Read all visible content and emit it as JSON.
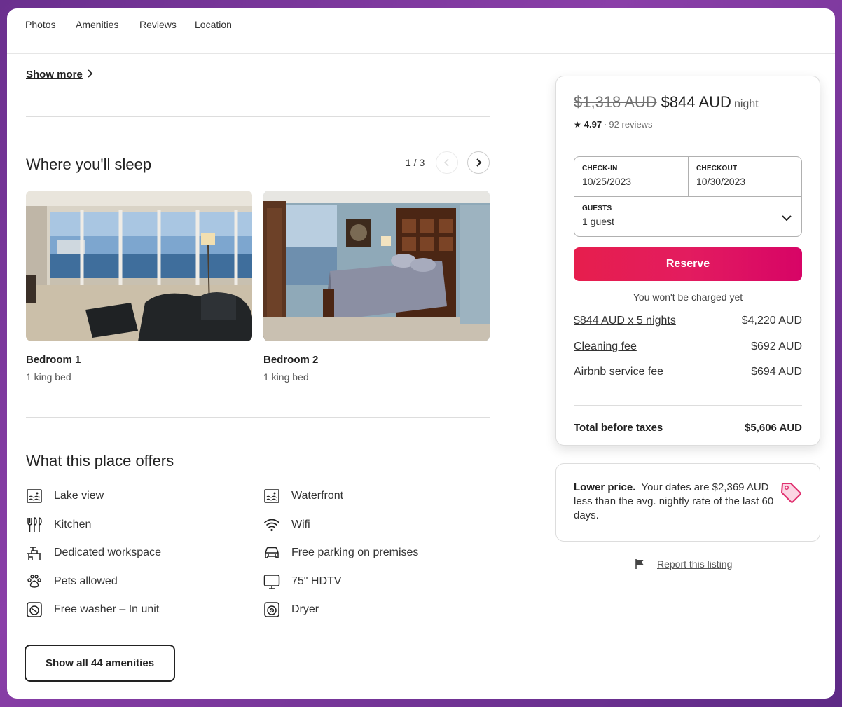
{
  "nav": {
    "tabs": [
      "Photos",
      "Amenities",
      "Reviews",
      "Location"
    ]
  },
  "show_more": "Show more",
  "sleep": {
    "title": "Where you'll sleep",
    "pager": "1 / 3",
    "rooms": [
      {
        "name": "Bedroom 1",
        "bed": "1 king bed"
      },
      {
        "name": "Bedroom 2",
        "bed": "1 king bed"
      }
    ]
  },
  "offers": {
    "title": "What this place offers",
    "amenities": [
      {
        "label": "Lake view",
        "icon": "lake-view-icon"
      },
      {
        "label": "Waterfront",
        "icon": "waterfront-icon"
      },
      {
        "label": "Kitchen",
        "icon": "kitchen-icon"
      },
      {
        "label": "Wifi",
        "icon": "wifi-icon"
      },
      {
        "label": "Dedicated workspace",
        "icon": "workspace-icon"
      },
      {
        "label": "Free parking on premises",
        "icon": "car-icon"
      },
      {
        "label": "Pets allowed",
        "icon": "paw-icon"
      },
      {
        "label": "75\" HDTV",
        "icon": "tv-icon"
      },
      {
        "label": "Free washer – In unit",
        "icon": "washer-icon"
      },
      {
        "label": "Dryer",
        "icon": "dryer-icon"
      }
    ],
    "show_all": "Show all 44 amenities"
  },
  "booking": {
    "old_price": "$1,318 AUD",
    "new_price": "$844 AUD",
    "per": "night",
    "rating": "4.97",
    "sep": "·",
    "reviews": "92 reviews",
    "checkin_label": "CHECK-IN",
    "checkin_value": "10/25/2023",
    "checkout_label": "CHECKOUT",
    "checkout_value": "10/30/2023",
    "guests_label": "GUESTS",
    "guests_value": "1 guest",
    "reserve": "Reserve",
    "no_charge": "You won't be charged yet",
    "fees": [
      {
        "label": "$844 AUD x 5 nights",
        "amount": "$4,220 AUD"
      },
      {
        "label": "Cleaning fee",
        "amount": "$692 AUD"
      },
      {
        "label": "Airbnb service fee",
        "amount": "$694 AUD"
      }
    ],
    "total_label": "Total before taxes",
    "total_amount": "$5,606 AUD"
  },
  "lower_price": {
    "bold": "Lower price.",
    "text": "Your dates are $2,369 AUD less than the avg. nightly rate of the last 60 days."
  },
  "report": "Report this listing",
  "colors": {
    "accent": "#e31c5f",
    "text": "#222222",
    "muted": "#717171",
    "border": "#dddddd",
    "tag_pink": "#e0306f"
  }
}
